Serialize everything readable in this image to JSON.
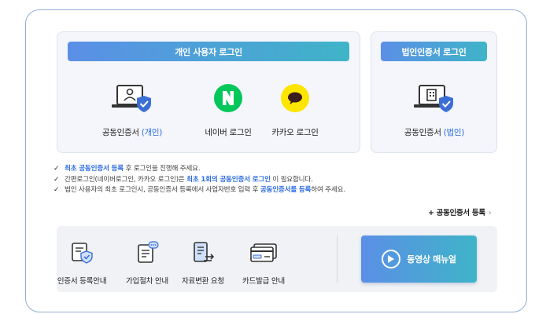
{
  "personal": {
    "title": "개인 사용자 로그인",
    "cert": {
      "label": "공동인증서 ",
      "highlight": "(개인)"
    },
    "naver": {
      "label": "네이버 로그인"
    },
    "kakao": {
      "label": "카카오 로그인"
    }
  },
  "corporate": {
    "title": "법인인증서 로그인",
    "cert": {
      "label": "공동인증서 ",
      "highlight": "(법인)"
    }
  },
  "notes": [
    {
      "parts": [
        {
          "t": "최초 공동인증서 등록",
          "b": true
        },
        {
          "t": " 후 로그인을 진행해 주세요.",
          "b": false
        }
      ]
    },
    {
      "parts": [
        {
          "t": "간편로그인(네이버로그인, 카카오 로그인)은 ",
          "b": false
        },
        {
          "t": "최초 1회의 공동인증서 로그인",
          "b": true
        },
        {
          "t": " 이 필요합니다.",
          "b": false
        }
      ]
    },
    {
      "parts": [
        {
          "t": "법인 사용자의 최초 로그인시, 공동인증서 등록에서 사업자번호 입력 후 ",
          "b": false
        },
        {
          "t": "공동인증서를 등록",
          "b": true
        },
        {
          "t": "하여 주세요.",
          "b": false
        }
      ]
    }
  ],
  "register_link": "+ 공동인증서 등록",
  "bottom_items": [
    {
      "label": "인증서 등록안내",
      "icon": "certificate-shield-icon"
    },
    {
      "label": "가입절차 안내",
      "icon": "document-chat-icon"
    },
    {
      "label": "자료변환 요청",
      "icon": "document-convert-icon"
    },
    {
      "label": "카드발급 안내",
      "icon": "card-icon"
    }
  ],
  "video_button": {
    "label": "동영상 매뉴얼"
  },
  "colors": {
    "accent": "#2d6cdf",
    "gradient_start": "#5b8fe6",
    "gradient_end": "#3fb4c8",
    "naver": "#03c75a",
    "kakao": "#fee500"
  }
}
